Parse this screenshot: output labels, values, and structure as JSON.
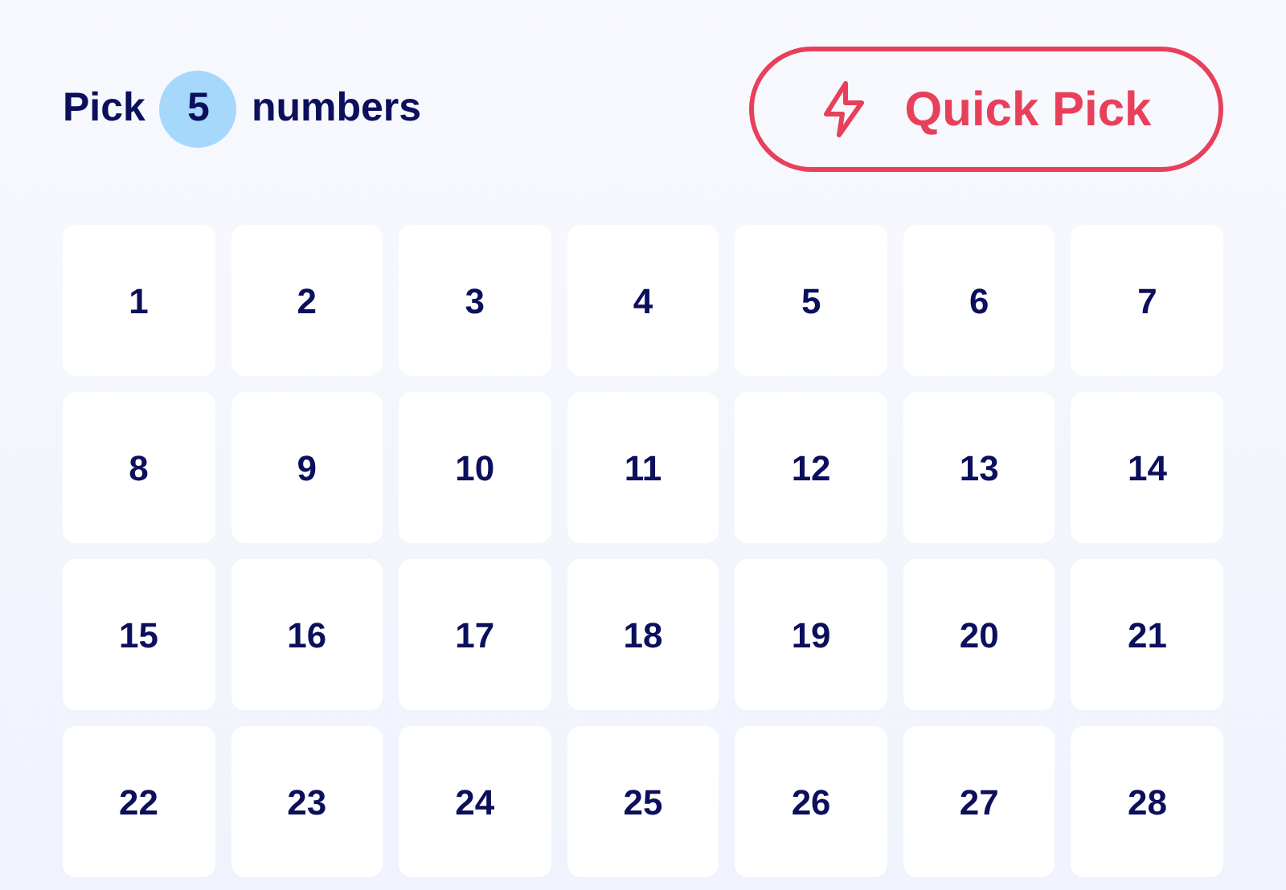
{
  "header": {
    "prefix": "Pick",
    "count": "5",
    "suffix": "numbers"
  },
  "quick_pick": {
    "label": "Quick Pick"
  },
  "numbers": [
    "1",
    "2",
    "3",
    "4",
    "5",
    "6",
    "7",
    "8",
    "9",
    "10",
    "11",
    "12",
    "13",
    "14",
    "15",
    "16",
    "17",
    "18",
    "19",
    "20",
    "21",
    "22",
    "23",
    "24",
    "25",
    "26",
    "27",
    "28"
  ]
}
